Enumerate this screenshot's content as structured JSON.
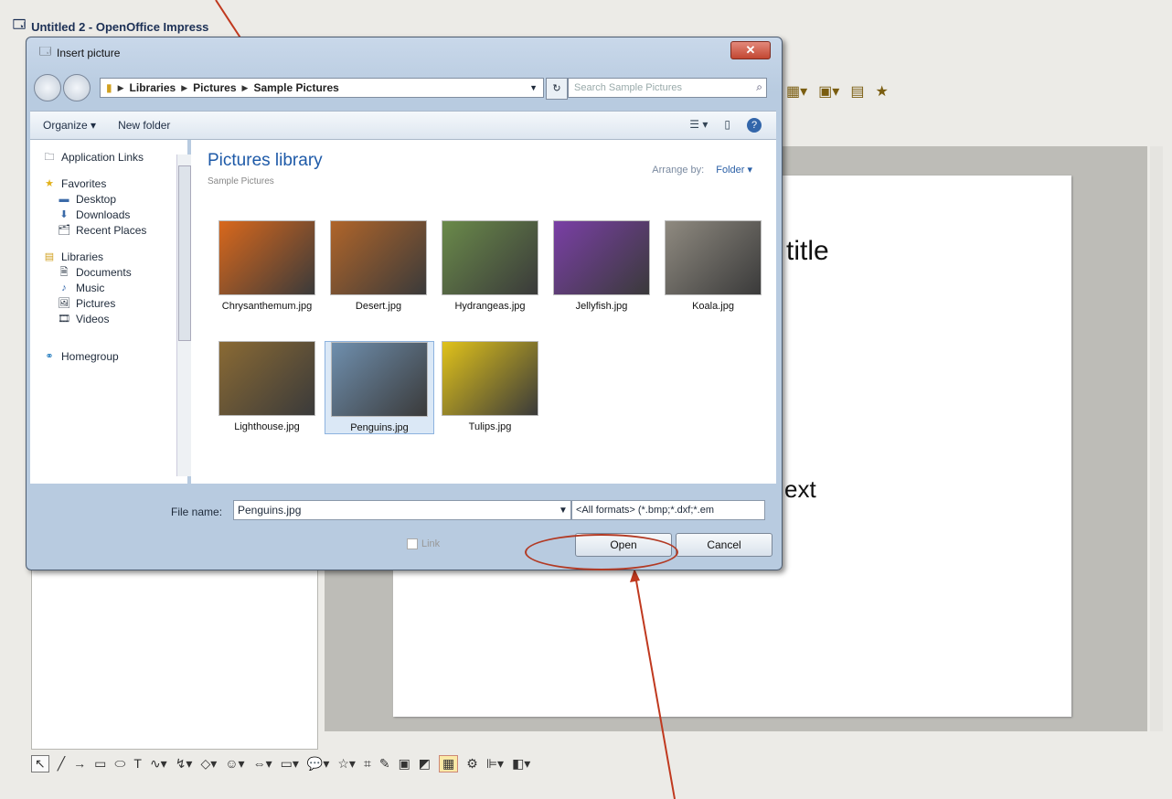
{
  "app": {
    "title": "Untitled 2 - OpenOffice Impress",
    "slide": {
      "title_fragment": "title",
      "text_fragment": "ext"
    }
  },
  "dialog": {
    "title": "Insert picture",
    "close_label": "✕",
    "breadcrumb": [
      "Libraries",
      "Pictures",
      "Sample Pictures"
    ],
    "search_placeholder": "Search Sample Pictures",
    "toolbar": {
      "organize_label": "Organize ▾",
      "new_folder_label": "New folder"
    },
    "nav": {
      "application_links": "Application Links",
      "favorites": "Favorites",
      "favorites_items": [
        "Desktop",
        "Downloads",
        "Recent Places"
      ],
      "libraries": "Libraries",
      "libraries_items": [
        "Documents",
        "Music",
        "Pictures",
        "Videos"
      ],
      "homegroup": "Homegroup"
    },
    "library": {
      "title": "Pictures library",
      "subtitle": "Sample Pictures",
      "arrange_by_label": "Arrange by:",
      "arrange_by_value": "Folder ▾"
    },
    "files": [
      {
        "name": "Chrysanthemum.jpg",
        "color": "#d9681c",
        "selected": false
      },
      {
        "name": "Desert.jpg",
        "color": "#b0652a",
        "selected": false
      },
      {
        "name": "Hydrangeas.jpg",
        "color": "#6a8a4a",
        "selected": false
      },
      {
        "name": "Jellyfish.jpg",
        "color": "#7a3fa6",
        "selected": false
      },
      {
        "name": "Koala.jpg",
        "color": "#8f8a80",
        "selected": false
      },
      {
        "name": "Lighthouse.jpg",
        "color": "#8a6a34",
        "selected": false
      },
      {
        "name": "Penguins.jpg",
        "color": "#6f8fae",
        "selected": true
      },
      {
        "name": "Tulips.jpg",
        "color": "#e0c21a",
        "selected": false
      }
    ],
    "file_name_label": "File name:",
    "file_name_value": "Penguins.jpg",
    "filter_value": "<All formats> (*.bmp;*.dxf;*.em",
    "link_label": "Link",
    "open_label": "Open",
    "cancel_label": "Cancel"
  },
  "colors": {
    "accent": "#1e5aa8",
    "annotation": "#c0391f"
  }
}
